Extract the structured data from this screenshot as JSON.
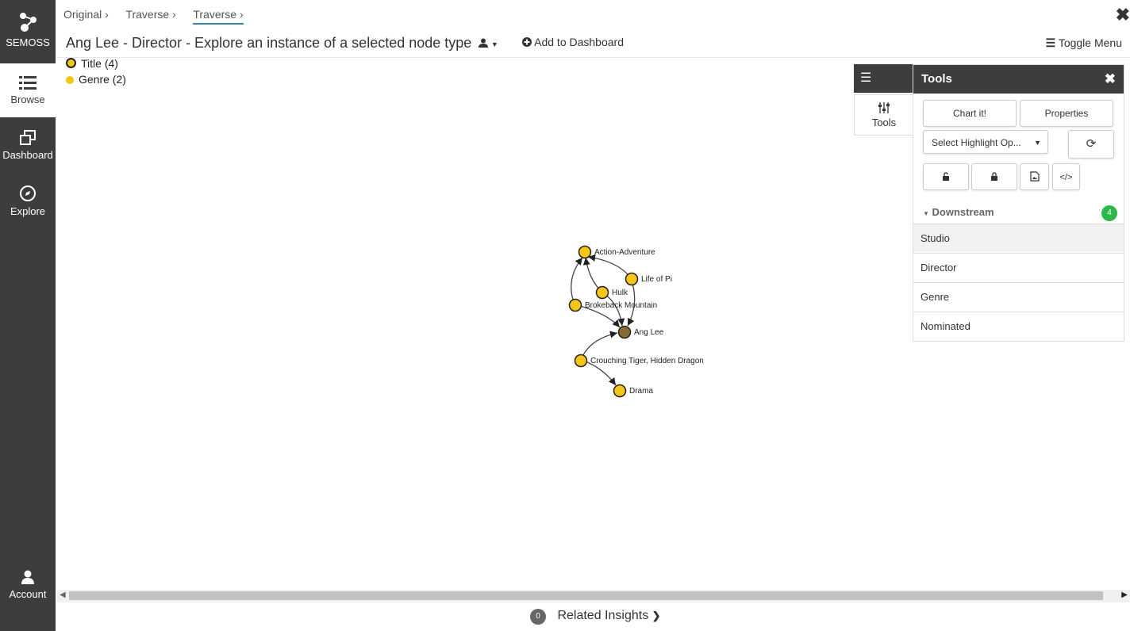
{
  "sidebar": {
    "brand": "SEMOSS",
    "items": [
      {
        "label": "Browse"
      },
      {
        "label": "Dashboard"
      },
      {
        "label": "Explore"
      }
    ],
    "account": "Account"
  },
  "breadcrumb": [
    "Original",
    "Traverse",
    "Traverse"
  ],
  "header": {
    "title": "Ang Lee - Director - Explore an instance of a selected node type",
    "add_dashboard": "Add to Dashboard",
    "toggle_menu": "Toggle Menu"
  },
  "legend": [
    {
      "label": "Title (4)",
      "color": "#f5c518"
    },
    {
      "label": "Genre (2)",
      "color": "#f5c518"
    }
  ],
  "graph": {
    "nodes": [
      {
        "id": "Action-Adventure",
        "type": "Genre",
        "color": "#f5c518"
      },
      {
        "id": "Life of Pi",
        "type": "Title",
        "color": "#f5c518"
      },
      {
        "id": "Hulk",
        "type": "Title",
        "color": "#f5c518"
      },
      {
        "id": "Brokeback Mountain",
        "type": "Title",
        "color": "#f5c518"
      },
      {
        "id": "Ang Lee",
        "type": "Director",
        "color": "#8a6a2e"
      },
      {
        "id": "Crouching Tiger, Hidden Dragon",
        "type": "Title",
        "color": "#f5c518"
      },
      {
        "id": "Drama",
        "type": "Genre",
        "color": "#f5c518"
      }
    ]
  },
  "tools": {
    "tab_label": "Tools",
    "title": "Tools",
    "chart_button": "Chart it!",
    "properties_button": "Properties",
    "highlight_placeholder": "Select Highlight Op...",
    "downstream_label": "Downstream",
    "downstream_count": "4",
    "downstream_items": [
      "Studio",
      "Director",
      "Genre",
      "Nominated"
    ]
  },
  "related": {
    "count": "0",
    "label": "Related Insights"
  }
}
